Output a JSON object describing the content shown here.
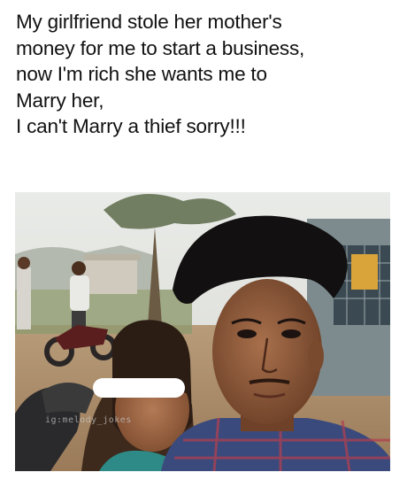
{
  "caption": {
    "lines": [
      "My girlfriend stole her mother's",
      "money for me to start a business,",
      "now I'm rich she wants me to",
      "Marry her,",
      "I can't Marry a thief sorry!!!"
    ]
  },
  "photo": {
    "watermark": "ig:melody_jokes",
    "eye_censor_color": "#ffffff"
  }
}
